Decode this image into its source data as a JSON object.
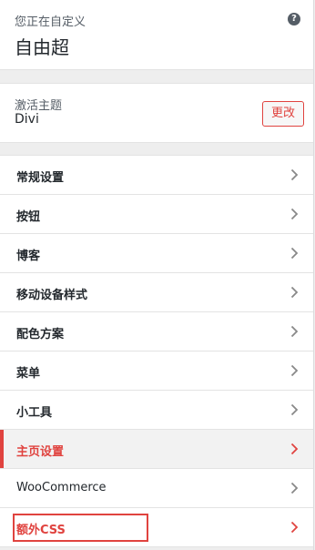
{
  "header": {
    "customizing_label": "您正在自定义",
    "site_title": "自由超",
    "help_symbol": "?"
  },
  "theme": {
    "label": "激活主题",
    "name": "Divi",
    "change_label": "更改"
  },
  "menu": {
    "items": [
      {
        "label": "常规设置"
      },
      {
        "label": "按钮"
      },
      {
        "label": "博客"
      },
      {
        "label": "移动设备样式"
      },
      {
        "label": "配色方案"
      },
      {
        "label": "菜单"
      },
      {
        "label": "小工具"
      },
      {
        "label": "主页设置",
        "state": "active"
      },
      {
        "label": "WooCommerce"
      },
      {
        "label": "额外CSS",
        "state": "highlighted"
      }
    ]
  },
  "colors": {
    "accent": "#e0433f",
    "text_dark": "#23282d",
    "text_muted": "#555d66",
    "panel_bg": "#eeeeee",
    "chevron": "#888888"
  }
}
